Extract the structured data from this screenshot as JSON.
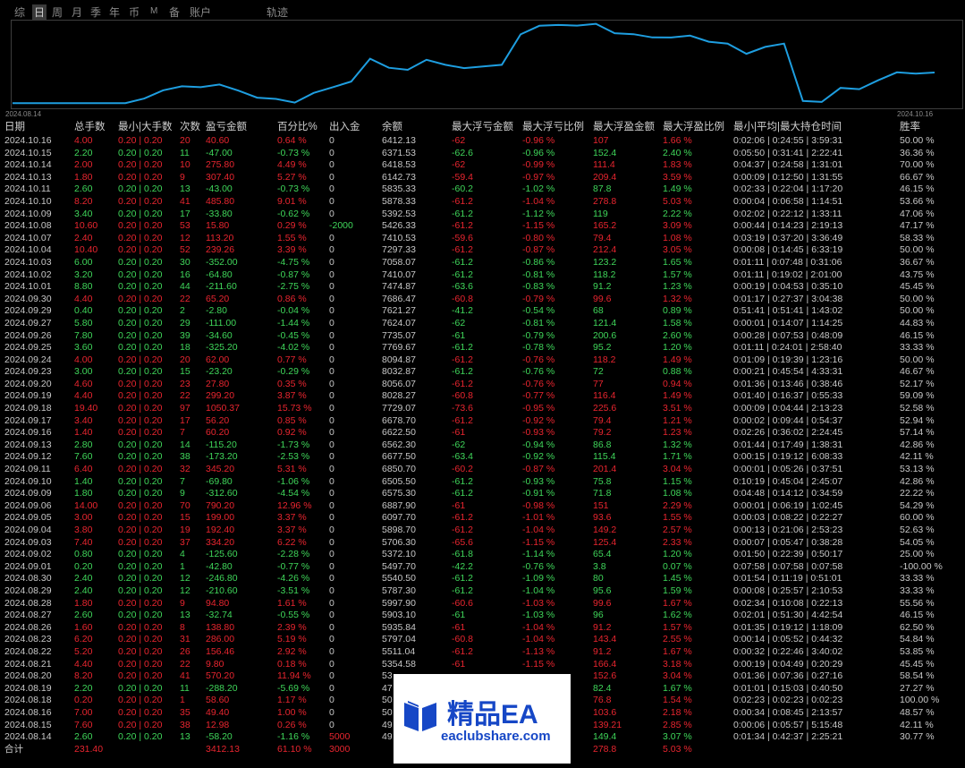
{
  "tabs": [
    "综",
    "日",
    "周",
    "月",
    "季",
    "年",
    "币",
    "M",
    "备",
    "账户",
    "轨迹"
  ],
  "selected_tab": "日",
  "chart": {
    "start_date": "2024.08.14",
    "end_date": "2024.10.16",
    "line_color": "#1e9ee0"
  },
  "columns": [
    "日期",
    "总手数",
    "最小|大手数",
    "次数",
    "盈亏金额",
    "百分比%",
    "出入金",
    "余额",
    "最大浮亏金额",
    "最大浮亏比例",
    "最大浮盈金额",
    "最大浮盈比例",
    "最小|平均|最大持仓时间",
    "胜率"
  ],
  "rows": [
    [
      "2024.10.16",
      "4.00",
      "0.20 | 0.20",
      "20",
      "40.60",
      "0.64 %",
      "0",
      "6412.13",
      "-62",
      "-0.96 %",
      "107",
      "1.66 %",
      "0:02:06 | 0:24:55 | 3:59:31",
      "50.00 %"
    ],
    [
      "2024.10.15",
      "2.20",
      "0.20 | 0.20",
      "11",
      "-47.00",
      "-0.73 %",
      "0",
      "6371.53",
      "-62.6",
      "-0.96 %",
      "152.4",
      "2.40 %",
      "0:05:50 | 0:31:41 | 2:22:41",
      "36.36 %"
    ],
    [
      "2024.10.14",
      "2.00",
      "0.20 | 0.20",
      "10",
      "275.80",
      "4.49 %",
      "0",
      "6418.53",
      "-62",
      "-0.99 %",
      "111.4",
      "1.83 %",
      "0:04:37 | 0:24:58 | 1:31:01",
      "70.00 %"
    ],
    [
      "2024.10.13",
      "1.80",
      "0.20 | 0.20",
      "9",
      "307.40",
      "5.27 %",
      "0",
      "6142.73",
      "-59.4",
      "-0.97 %",
      "209.4",
      "3.59 %",
      "0:00:09 | 0:12:50 | 1:31:55",
      "66.67 %"
    ],
    [
      "2024.10.11",
      "2.60",
      "0.20 | 0.20",
      "13",
      "-43.00",
      "-0.73 %",
      "0",
      "5835.33",
      "-60.2",
      "-1.02 %",
      "87.8",
      "1.49 %",
      "0:02:33 | 0:22:04 | 1:17:20",
      "46.15 %"
    ],
    [
      "2024.10.10",
      "8.20",
      "0.20 | 0.20",
      "41",
      "485.80",
      "9.01 %",
      "0",
      "5878.33",
      "-61.2",
      "-1.04 %",
      "278.8",
      "5.03 %",
      "0:00:04 | 0:06:58 | 1:14:51",
      "53.66 %"
    ],
    [
      "2024.10.09",
      "3.40",
      "0.20 | 0.20",
      "17",
      "-33.80",
      "-0.62 %",
      "0",
      "5392.53",
      "-61.2",
      "-1.12 %",
      "119",
      "2.22 %",
      "0:02:02 | 0:22:12 | 1:33:11",
      "47.06 %"
    ],
    [
      "2024.10.08",
      "10.60",
      "0.20 | 0.20",
      "53",
      "15.80",
      "0.29 %",
      "-2000",
      "5426.33",
      "-61.2",
      "-1.15 %",
      "165.2",
      "3.09 %",
      "0:00:44 | 0:14:23 | 2:19:13",
      "47.17 %"
    ],
    [
      "2024.10.07",
      "2.40",
      "0.20 | 0.20",
      "12",
      "113.20",
      "1.55 %",
      "0",
      "7410.53",
      "-59.6",
      "-0.80 %",
      "79.4",
      "1.08 %",
      "0:03:19 | 0:37:20 | 3:36:49",
      "58.33 %"
    ],
    [
      "2024.10.04",
      "10.40",
      "0.20 | 0.20",
      "52",
      "239.26",
      "3.39 %",
      "0",
      "7297.33",
      "-61.2",
      "-0.87 %",
      "212.4",
      "3.05 %",
      "0:00:08 | 0:14:45 | 6:33:19",
      "50.00 %"
    ],
    [
      "2024.10.03",
      "6.00",
      "0.20 | 0.20",
      "30",
      "-352.00",
      "-4.75 %",
      "0",
      "7058.07",
      "-61.2",
      "-0.86 %",
      "123.2",
      "1.65 %",
      "0:01:11 | 0:07:48 | 0:31:06",
      "36.67 %"
    ],
    [
      "2024.10.02",
      "3.20",
      "0.20 | 0.20",
      "16",
      "-64.80",
      "-0.87 %",
      "0",
      "7410.07",
      "-61.2",
      "-0.81 %",
      "118.2",
      "1.57 %",
      "0:01:11 | 0:19:02 | 2:01:00",
      "43.75 %"
    ],
    [
      "2024.10.01",
      "8.80",
      "0.20 | 0.20",
      "44",
      "-211.60",
      "-2.75 %",
      "0",
      "7474.87",
      "-63.6",
      "-0.83 %",
      "91.2",
      "1.23 %",
      "0:00:19 | 0:04:53 | 0:35:10",
      "45.45 %"
    ],
    [
      "2024.09.30",
      "4.40",
      "0.20 | 0.20",
      "22",
      "65.20",
      "0.86 %",
      "0",
      "7686.47",
      "-60.8",
      "-0.79 %",
      "99.6",
      "1.32 %",
      "0:01:17 | 0:27:37 | 3:04:38",
      "50.00 %"
    ],
    [
      "2024.09.29",
      "0.40",
      "0.20 | 0.20",
      "2",
      "-2.80",
      "-0.04 %",
      "0",
      "7621.27",
      "-41.2",
      "-0.54 %",
      "68",
      "0.89 %",
      "0:51:41 | 0:51:41 | 1:43:02",
      "50.00 %"
    ],
    [
      "2024.09.27",
      "5.80",
      "0.20 | 0.20",
      "29",
      "-111.00",
      "-1.44 %",
      "0",
      "7624.07",
      "-62",
      "-0.81 %",
      "121.4",
      "1.58 %",
      "0:00:01 | 0:14:07 | 1:14:25",
      "44.83 %"
    ],
    [
      "2024.09.26",
      "7.80",
      "0.20 | 0.20",
      "39",
      "-34.60",
      "-0.45 %",
      "0",
      "7735.07",
      "-61",
      "-0.79 %",
      "200.6",
      "2.60 %",
      "0:00:28 | 0:07:53 | 0:48:09",
      "46.15 %"
    ],
    [
      "2024.09.25",
      "3.60",
      "0.20 | 0.20",
      "18",
      "-325.20",
      "-4.02 %",
      "0",
      "7769.67",
      "-61.2",
      "-0.78 %",
      "95.2",
      "1.20 %",
      "0:01:11 | 0:24:01 | 2:58:40",
      "33.33 %"
    ],
    [
      "2024.09.24",
      "4.00",
      "0.20 | 0.20",
      "20",
      "62.00",
      "0.77 %",
      "0",
      "8094.87",
      "-61.2",
      "-0.76 %",
      "118.2",
      "1.49 %",
      "0:01:09 | 0:19:39 | 1:23:16",
      "50.00 %"
    ],
    [
      "2024.09.23",
      "3.00",
      "0.20 | 0.20",
      "15",
      "-23.20",
      "-0.29 %",
      "0",
      "8032.87",
      "-61.2",
      "-0.76 %",
      "72",
      "0.88 %",
      "0:00:21 | 0:45:54 | 4:33:31",
      "46.67 %"
    ],
    [
      "2024.09.20",
      "4.60",
      "0.20 | 0.20",
      "23",
      "27.80",
      "0.35 %",
      "0",
      "8056.07",
      "-61.2",
      "-0.76 %",
      "77",
      "0.94 %",
      "0:01:36 | 0:13:46 | 0:38:46",
      "52.17 %"
    ],
    [
      "2024.09.19",
      "4.40",
      "0.20 | 0.20",
      "22",
      "299.20",
      "3.87 %",
      "0",
      "8028.27",
      "-60.8",
      "-0.77 %",
      "116.4",
      "1.49 %",
      "0:01:40 | 0:16:37 | 0:55:33",
      "59.09 %"
    ],
    [
      "2024.09.18",
      "19.40",
      "0.20 | 0.20",
      "97",
      "1050.37",
      "15.73 %",
      "0",
      "7729.07",
      "-73.6",
      "-0.95 %",
      "225.6",
      "3.51 %",
      "0:00:09 | 0:04:44 | 2:13:23",
      "52.58 %"
    ],
    [
      "2024.09.17",
      "3.40",
      "0.20 | 0.20",
      "17",
      "56.20",
      "0.85 %",
      "0",
      "6678.70",
      "-61.2",
      "-0.92 %",
      "79.4",
      "1.21 %",
      "0:00:02 | 0:09:44 | 0:54:37",
      "52.94 %"
    ],
    [
      "2024.09.16",
      "1.40",
      "0.20 | 0.20",
      "7",
      "60.20",
      "0.92 %",
      "0",
      "6622.50",
      "-61",
      "-0.93 %",
      "79.2",
      "1.23 %",
      "0:02:26 | 0:36:02 | 2:24:45",
      "57.14 %"
    ],
    [
      "2024.09.13",
      "2.80",
      "0.20 | 0.20",
      "14",
      "-115.20",
      "-1.73 %",
      "0",
      "6562.30",
      "-62",
      "-0.94 %",
      "86.8",
      "1.32 %",
      "0:01:44 | 0:17:49 | 1:38:31",
      "42.86 %"
    ],
    [
      "2024.09.12",
      "7.60",
      "0.20 | 0.20",
      "38",
      "-173.20",
      "-2.53 %",
      "0",
      "6677.50",
      "-63.4",
      "-0.92 %",
      "115.4",
      "1.71 %",
      "0:00:15 | 0:19:12 | 6:08:33",
      "42.11 %"
    ],
    [
      "2024.09.11",
      "6.40",
      "0.20 | 0.20",
      "32",
      "345.20",
      "5.31 %",
      "0",
      "6850.70",
      "-60.2",
      "-0.87 %",
      "201.4",
      "3.04 %",
      "0:00:01 | 0:05:26 | 0:37:51",
      "53.13 %"
    ],
    [
      "2024.09.10",
      "1.40",
      "0.20 | 0.20",
      "7",
      "-69.80",
      "-1.06 %",
      "0",
      "6505.50",
      "-61.2",
      "-0.93 %",
      "75.8",
      "1.15 %",
      "0:10:19 | 0:45:04 | 2:45:07",
      "42.86 %"
    ],
    [
      "2024.09.09",
      "1.80",
      "0.20 | 0.20",
      "9",
      "-312.60",
      "-4.54 %",
      "0",
      "6575.30",
      "-61.2",
      "-0.91 %",
      "71.8",
      "1.08 %",
      "0:04:48 | 0:14:12 | 0:34:59",
      "22.22 %"
    ],
    [
      "2024.09.06",
      "14.00",
      "0.20 | 0.20",
      "70",
      "790.20",
      "12.96 %",
      "0",
      "6887.90",
      "-61",
      "-0.98 %",
      "151",
      "2.29 %",
      "0:00:01 | 0:06:19 | 1:02:45",
      "54.29 %"
    ],
    [
      "2024.09.05",
      "3.00",
      "0.20 | 0.20",
      "15",
      "199.00",
      "3.37 %",
      "0",
      "6097.70",
      "-61.2",
      "-1.01 %",
      "93.6",
      "1.55 %",
      "0:00:03 | 0:08:22 | 0:22:27",
      "60.00 %"
    ],
    [
      "2024.09.04",
      "3.80",
      "0.20 | 0.20",
      "19",
      "192.40",
      "3.37 %",
      "0",
      "5898.70",
      "-61.2",
      "-1.04 %",
      "149.2",
      "2.57 %",
      "0:00:13 | 0:21:06 | 2:53:23",
      "52.63 %"
    ],
    [
      "2024.09.03",
      "7.40",
      "0.20 | 0.20",
      "37",
      "334.20",
      "6.22 %",
      "0",
      "5706.30",
      "-65.6",
      "-1.15 %",
      "125.4",
      "2.33 %",
      "0:00:07 | 0:05:47 | 0:38:28",
      "54.05 %"
    ],
    [
      "2024.09.02",
      "0.80",
      "0.20 | 0.20",
      "4",
      "-125.60",
      "-2.28 %",
      "0",
      "5372.10",
      "-61.8",
      "-1.14 %",
      "65.4",
      "1.20 %",
      "0:01:50 | 0:22:39 | 0:50:17",
      "25.00 %"
    ],
    [
      "2024.09.01",
      "0.20",
      "0.20 | 0.20",
      "1",
      "-42.80",
      "-0.77 %",
      "0",
      "5497.70",
      "-42.2",
      "-0.76 %",
      "3.8",
      "0.07 %",
      "0:07:58 | 0:07:58 | 0:07:58",
      "-100.00 %"
    ],
    [
      "2024.08.30",
      "2.40",
      "0.20 | 0.20",
      "12",
      "-246.80",
      "-4.26 %",
      "0",
      "5540.50",
      "-61.2",
      "-1.09 %",
      "80",
      "1.45 %",
      "0:01:54 | 0:11:19 | 0:51:01",
      "33.33 %"
    ],
    [
      "2024.08.29",
      "2.40",
      "0.20 | 0.20",
      "12",
      "-210.60",
      "-3.51 %",
      "0",
      "5787.30",
      "-61.2",
      "-1.04 %",
      "95.6",
      "1.59 %",
      "0:00:08 | 0:25:57 | 2:10:53",
      "33.33 %"
    ],
    [
      "2024.08.28",
      "1.80",
      "0.20 | 0.20",
      "9",
      "94.80",
      "1.61 %",
      "0",
      "5997.90",
      "-60.6",
      "-1.03 %",
      "99.6",
      "1.67 %",
      "0:02:34 | 0:10:08 | 0:22:13",
      "55.56 %"
    ],
    [
      "2024.08.27",
      "2.60",
      "0.20 | 0.20",
      "13",
      "-32.74",
      "-0.55 %",
      "0",
      "5903.10",
      "-61",
      "-1.03 %",
      "96",
      "1.62 %",
      "0:02:01 | 0:51:30 | 4:42:54",
      "46.15 %"
    ],
    [
      "2024.08.26",
      "1.60",
      "0.20 | 0.20",
      "8",
      "138.80",
      "2.39 %",
      "0",
      "5935.84",
      "-61",
      "-1.04 %",
      "91.2",
      "1.57 %",
      "0:01:35 | 0:19:12 | 1:18:09",
      "62.50 %"
    ],
    [
      "2024.08.23",
      "6.20",
      "0.20 | 0.20",
      "31",
      "286.00",
      "5.19 %",
      "0",
      "5797.04",
      "-60.8",
      "-1.04 %",
      "143.4",
      "2.55 %",
      "0:00:14 | 0:05:52 | 0:44:32",
      "54.84 %"
    ],
    [
      "2024.08.22",
      "5.20",
      "0.20 | 0.20",
      "26",
      "156.46",
      "2.92 %",
      "0",
      "5511.04",
      "-61.2",
      "-1.13 %",
      "91.2",
      "1.67 %",
      "0:00:32 | 0:22:46 | 3:40:02",
      "53.85 %"
    ],
    [
      "2024.08.21",
      "4.40",
      "0.20 | 0.20",
      "22",
      "9.80",
      "0.18 %",
      "0",
      "5354.58",
      "-61",
      "-1.15 %",
      "166.4",
      "3.18 %",
      "0:00:19 | 0:04:49 | 0:20:29",
      "45.45 %"
    ],
    [
      "2024.08.20",
      "8.20",
      "0.20 | 0.20",
      "41",
      "570.20",
      "11.94 %",
      "0",
      "53",
      "",
      "",
      "152.6",
      "3.04 %",
      "0:01:36 | 0:07:36 | 0:27:16",
      "58.54 %"
    ],
    [
      "2024.08.19",
      "2.20",
      "0.20 | 0.20",
      "11",
      "-288.20",
      "-5.69 %",
      "0",
      "47",
      "",
      "",
      "82.4",
      "1.67 %",
      "0:01:01 | 0:15:03 | 0:40:50",
      "27.27 %"
    ],
    [
      "2024.08.18",
      "0.20",
      "0.20 | 0.20",
      "1",
      "58.60",
      "1.17 %",
      "0",
      "50",
      "",
      "",
      "76.8",
      "1.54 %",
      "0:02:23 | 0:02:23 | 0:02:23",
      "100.00 %"
    ],
    [
      "2024.08.16",
      "7.00",
      "0.20 | 0.20",
      "35",
      "49.40",
      "1.00 %",
      "0",
      "50",
      "",
      "",
      "103.6",
      "2.18 %",
      "0:00:34 | 0:08:45 | 2:13:57",
      "48.57 %"
    ],
    [
      "2024.08.15",
      "7.60",
      "0.20 | 0.20",
      "38",
      "12.98",
      "0.26 %",
      "0",
      "49",
      "",
      "",
      "139.21",
      "2.85 %",
      "0:00:06 | 0:05:57 | 5:15:48",
      "42.11 %"
    ],
    [
      "2024.08.14",
      "2.60",
      "0.20 | 0.20",
      "13",
      "-58.20",
      "-1.16 %",
      "5000",
      "49",
      "",
      "",
      "149.4",
      "3.07 %",
      "0:01:34 | 0:42:37 | 2:25:21",
      "30.77 %"
    ]
  ],
  "total": {
    "label": "合计",
    "lots": "231.40",
    "pnl": "3412.13",
    "pct": "61.10 %",
    "deposit": "3000",
    "max_float_profit": "278.8",
    "max_float_profit_pct": "5.03 %"
  },
  "watermark": {
    "title": "精品EA",
    "url": "eaclubshare.com",
    "color": "#1647c6"
  },
  "colors": {
    "positive": "#3fd65a",
    "negative": "#e8252f",
    "line": "#1e9ee0"
  }
}
